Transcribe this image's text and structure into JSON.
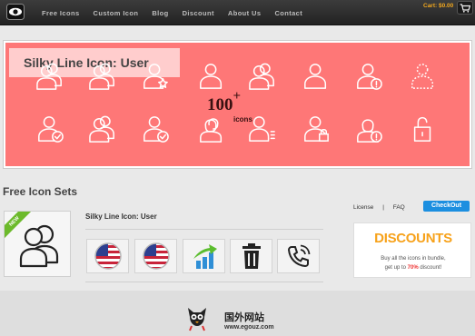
{
  "nav": {
    "items": [
      "Free Icons",
      "Custom Icon",
      "Blog",
      "Discount",
      "About Us",
      "Contact"
    ],
    "cart": "Cart: $0.00"
  },
  "banner": {
    "title": "Silky Line Icon: User",
    "count": "100",
    "count_plus": "+",
    "count_label": "icons",
    "icons": [
      "users-icon",
      "users-icon",
      "user-star-icon",
      "user-icon",
      "users-icon",
      "user-icon",
      "user-alert-icon",
      "user-dashed-icon",
      "user-check-icon",
      "users-icon",
      "user-check-icon",
      "users-female-icon",
      "user-list-icon",
      "user-lock-icon",
      "user-female-alert-icon",
      "lock-icon"
    ]
  },
  "section": {
    "title": "Free Icon Sets",
    "set_name": "Silky Line Icon: User",
    "ribbon": "NEW",
    "tiles": [
      "us-flag-icon",
      "us-flag-icon",
      "chart-up-icon",
      "trash-icon",
      "phone-call-icon"
    ]
  },
  "sidebar": {
    "license": "License",
    "sep": "|",
    "faq": "FAQ",
    "checkout": "CheckOut",
    "promo_title": "DISCOUNTS",
    "promo_line1": "Buy all the icons in bundle,",
    "promo_line2_pre": "get up to ",
    "promo_line2_pct": "70%",
    "promo_line2_post": " discount!"
  },
  "watermark": {
    "cn": "国外网站",
    "url": "www.egouz.com"
  },
  "colors": {
    "banner": "#fe7777",
    "accent": "#f7a21b",
    "checkout": "#1c8fe0",
    "ribbon": "#6cba2b"
  }
}
